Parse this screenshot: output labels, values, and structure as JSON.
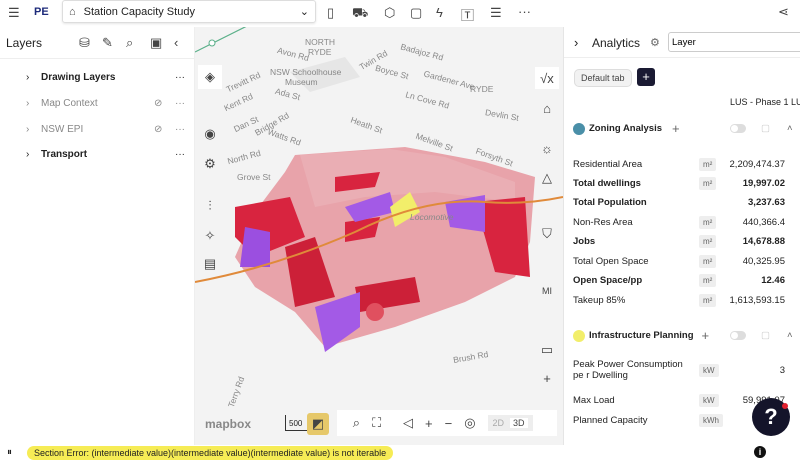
{
  "topbar": {
    "logo": "PE",
    "project": "Station Capacity Study",
    "more": "···"
  },
  "layers": {
    "title": "Layers",
    "items": [
      {
        "label": "Drawing Layers",
        "enabled": true
      },
      {
        "label": "Map Context",
        "enabled": false
      },
      {
        "label": "NSW EPI",
        "enabled": false
      },
      {
        "label": "Transport",
        "enabled": true
      }
    ]
  },
  "map": {
    "streets": [
      "NORTH",
      "RYDE",
      "Avon Rd",
      "Badajoz Rd",
      "Twin Rd",
      "Boyce St",
      "NSW Schoolhouse",
      "Museum",
      "Trevitt Rd",
      "Ada St",
      "Gardener Ave",
      "RYDE",
      "Kent Rd",
      "Ln Cove Rd",
      "Devlin St",
      "Dan St",
      "Bridge Rd",
      "Watts Rd",
      "Heath St",
      "Melville St",
      "Forsyth St",
      "North Rd",
      "Grove St",
      "Locomotive",
      "Brush Rd",
      "Terry Rd"
    ],
    "attribution": "mapbox",
    "scale": "500",
    "btn_2d": "2D",
    "btn_3d": "3D",
    "right_ctrl_text": "MI"
  },
  "analytics": {
    "title": "Analytics",
    "layer_input": "Layer",
    "tab": "Default tab",
    "scenario": "LUS - Phase 1  LU",
    "groups": [
      {
        "name": "Zoning Analysis",
        "color": "#4a8fa8",
        "rows": [
          {
            "label": "Residential Area",
            "unit": "m²",
            "value": "2,209,474.37",
            "bold": false
          },
          {
            "label": "Total dwellings",
            "unit": "m²",
            "value": "19,997.02",
            "bold": true
          },
          {
            "label": "Total Population",
            "unit": "",
            "value": "3,237.63",
            "bold": true
          },
          {
            "label": "Non-Res Area",
            "unit": "m²",
            "value": "440,366.4",
            "bold": false
          },
          {
            "label": "Jobs",
            "unit": "m²",
            "value": "14,678.88",
            "bold": true
          },
          {
            "label": "Total Open Space",
            "unit": "m²",
            "value": "40,325.95",
            "bold": false
          },
          {
            "label": "Open Space/pp",
            "unit": "m²",
            "value": "12.46",
            "bold": true
          },
          {
            "label": "Takeup 85%",
            "unit": "m²",
            "value": "1,613,593.15",
            "bold": false
          }
        ]
      },
      {
        "name": "Infrastructure Planning",
        "color": "#f2ee6a",
        "rows": [
          {
            "label": "Peak Power Consumption pe r Dwelling",
            "unit": "kW",
            "value": "3",
            "bold": false
          },
          {
            "label": "Max Load",
            "unit": "kW",
            "value": "59,991.07",
            "bold": false
          },
          {
            "label": "Planned Capacity",
            "unit": "kWh",
            "value": "",
            "bold": false
          }
        ]
      }
    ]
  },
  "status": {
    "pause": "⏸",
    "error": "Section Error: (intermediate value)(intermediate value)(intermediate value) is not iterable"
  },
  "help": "?"
}
